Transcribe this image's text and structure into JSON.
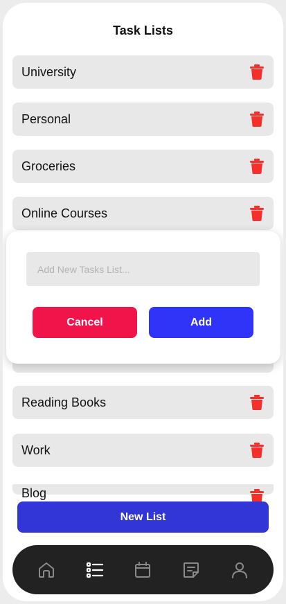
{
  "header": {
    "title": "Task Lists"
  },
  "lists": [
    {
      "label": "University"
    },
    {
      "label": "Personal"
    },
    {
      "label": "Groceries"
    },
    {
      "label": "Online Courses"
    },
    {
      "label": "Reading Books"
    },
    {
      "label": "Work"
    },
    {
      "label": "Blog"
    }
  ],
  "modal": {
    "input_placeholder": "Add New Tasks List...",
    "cancel_label": "Cancel",
    "add_label": "Add"
  },
  "new_list_label": "New List",
  "tabbar": {
    "items": [
      {
        "icon": "home-icon",
        "active": false
      },
      {
        "icon": "list-icon",
        "active": true
      },
      {
        "icon": "calendar-icon",
        "active": false
      },
      {
        "icon": "notes-icon",
        "active": false
      },
      {
        "icon": "user-icon",
        "active": false
      }
    ]
  },
  "colors": {
    "trash": "#f5302a",
    "cancel": "#f0144a",
    "add": "#2f34f8",
    "new_list": "#3336d6",
    "tabbar": "#222222"
  }
}
